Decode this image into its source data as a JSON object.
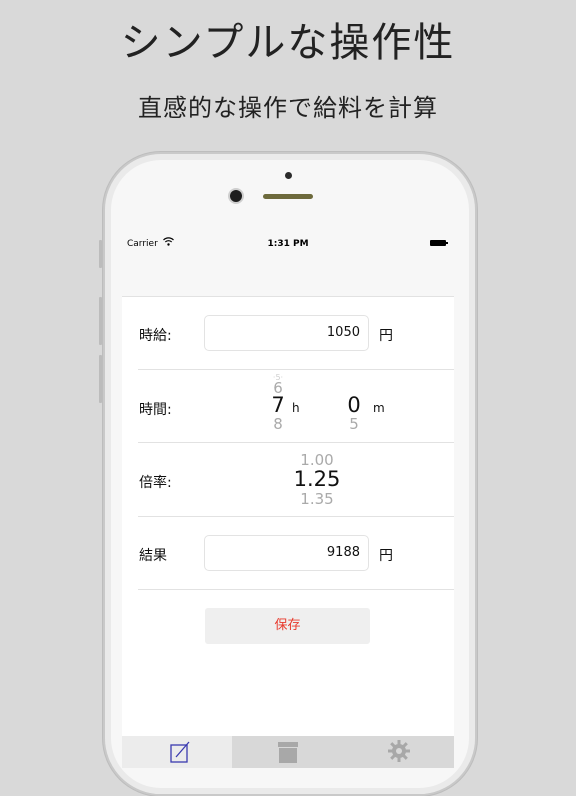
{
  "promo": {
    "headline": "シンプルな操作性",
    "subline": "直感的な操作で給料を計算"
  },
  "status_bar": {
    "carrier": "Carrier",
    "time": "1:31 PM"
  },
  "form": {
    "wage": {
      "label": "時給:",
      "value": "1050",
      "unit": "円"
    },
    "time": {
      "label": "時間:",
      "hours": {
        "prev": "6",
        "selected": "7",
        "next": "8",
        "unit": "h"
      },
      "minutes": {
        "selected": "0",
        "next": "5",
        "unit": "m"
      }
    },
    "rate": {
      "label": "倍率:",
      "prev": "1.00",
      "selected": "1.25",
      "next": "1.35"
    },
    "result": {
      "label": "結果",
      "value": "9188",
      "unit": "円"
    },
    "save_label": "保存"
  },
  "tabs": [
    {
      "icon": "compose-icon",
      "active": true
    },
    {
      "icon": "archive-icon",
      "active": false
    },
    {
      "icon": "gear-icon",
      "active": false
    }
  ],
  "colors": {
    "accent_red": "#e8392c",
    "tab_icon_blue": "#3b3bb0",
    "background": "#d9d9d9"
  }
}
